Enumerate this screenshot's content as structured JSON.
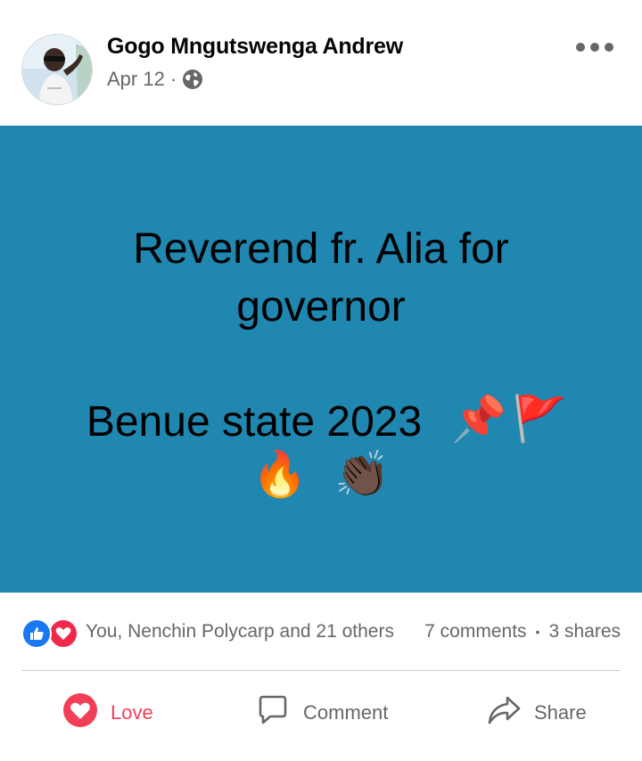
{
  "post": {
    "author": "Gogo Mngutswenga Andrew",
    "date": "Apr 12",
    "dot": "·",
    "privacy_icon": "globe-icon",
    "text_line1": "Reverend fr. Alia for",
    "text_line2": "governor",
    "text_line3": "Benue state 2023",
    "emojis": [
      "📌",
      "🚩",
      "🔥",
      "👏🏿"
    ],
    "background_color": "#1f87b0"
  },
  "stats": {
    "reactions_text": "You, Nenchin Polycarp and 21 others",
    "comments": "7 comments",
    "separator": "•",
    "shares": "3 shares"
  },
  "actions": {
    "love_label": "Love",
    "comment_label": "Comment",
    "share_label": "Share"
  },
  "colors": {
    "love": "#f33e58",
    "like": "#1877f2",
    "muted": "#65676b"
  }
}
